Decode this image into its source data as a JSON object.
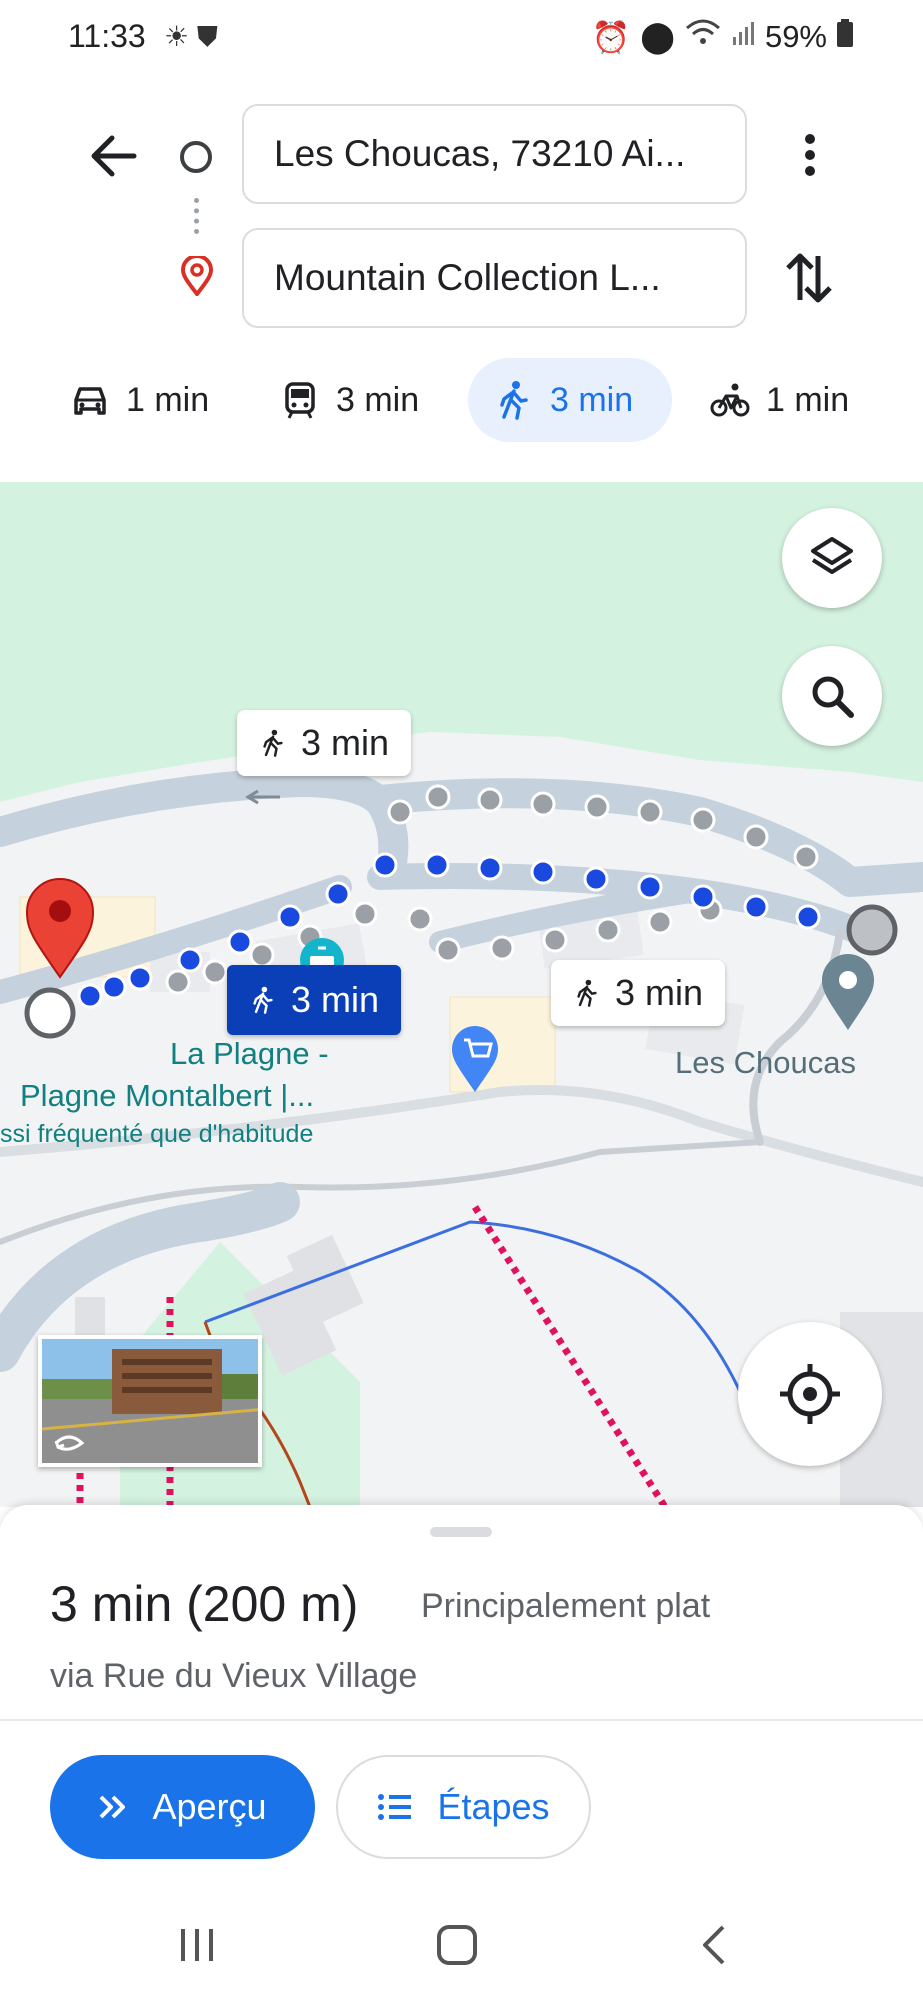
{
  "status_bar": {
    "time": "11:33",
    "battery": "59%"
  },
  "directions": {
    "origin_value": "Les Choucas, 73210 Ai...",
    "destination_value": "Mountain Collection L..."
  },
  "modes": [
    {
      "label": "1 min",
      "icon": "car-icon"
    },
    {
      "label": "3 min",
      "icon": "transit-icon"
    },
    {
      "label": "3 min",
      "icon": "walk-icon",
      "active": true
    },
    {
      "label": "1 min",
      "icon": "bike-icon"
    }
  ],
  "map": {
    "route_bubbles": {
      "alt_top": "3 min",
      "selected": "3 min",
      "alt_right": "3 min"
    },
    "labels": {
      "station_line1": "La Plagne -",
      "station_line2": "Plagne Montalbert |...",
      "station_line3": "ssi fréquenté que d'habitude",
      "les_choucas": "Les Choucas"
    },
    "colors": {
      "route_blue": "#1a49e0",
      "route_gray": "#9aa0a6",
      "park_green": "#d4f2e0",
      "pin_red": "#ea4335",
      "lift_red": "#e0115f"
    }
  },
  "sheet": {
    "duration": "3 min (200 m)",
    "terrain": "Principalement plat",
    "via": "via Rue du Vieux Village",
    "overview_label": "Aperçu",
    "steps_label": "Étapes"
  }
}
